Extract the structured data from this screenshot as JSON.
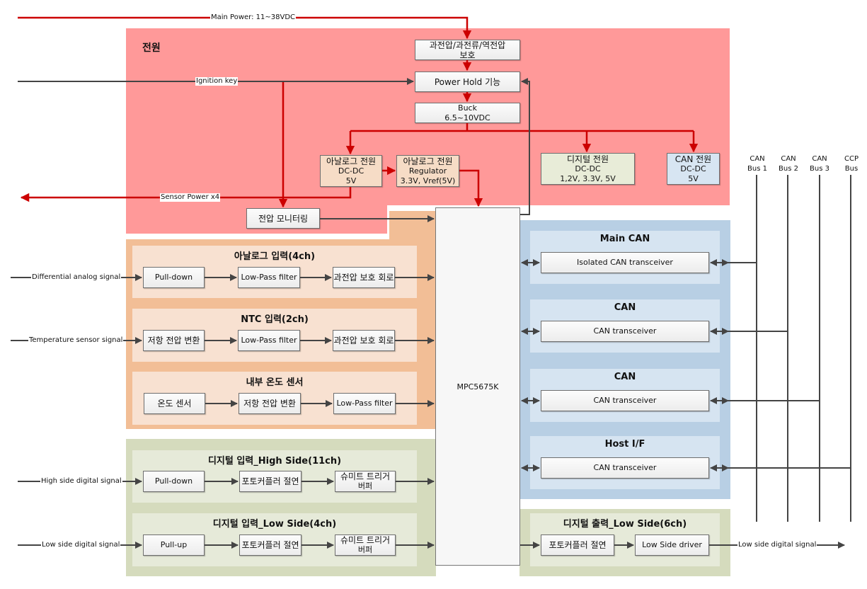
{
  "external_signals": {
    "main_power": "Main Power: 11~38VDC",
    "ignition_key": "Ignition key",
    "sensor_power": "Sensor Power x4",
    "differential_analog": "Differential analog signal",
    "temperature_sensor": "Temperature sensor signal",
    "high_side_digital": "High side digital signal",
    "low_side_digital_in": "Low side digital signal",
    "low_side_digital_out": "Low side digital signal"
  },
  "power_section": {
    "title": "전원",
    "protection": {
      "line1": "과전압/과전류/역전압",
      "line2": "보호"
    },
    "power_hold": "Power Hold 기능",
    "buck": {
      "line1": "Buck",
      "line2": "6.5~10VDC"
    },
    "analog_dcdc": {
      "line1": "아날로그 전원",
      "line2": "DC-DC",
      "line3": "5V"
    },
    "analog_regulator": {
      "line1": "아날로그 전원",
      "line2": "Regulator",
      "line3": "3.3V, Vref(5V)"
    },
    "digital_dcdc": {
      "line1": "디지털 전원",
      "line2": "DC-DC",
      "line3": "1,2V, 3.3V, 5V"
    },
    "can_dcdc": {
      "line1": "CAN 전원",
      "line2": "DC-DC",
      "line3": "5V"
    },
    "voltage_monitor": "전압 모니터링"
  },
  "analog_input": {
    "title": "아날로그 입력(4ch)",
    "blocks": [
      "Pull-down",
      "Low-Pass filter",
      "과전압 보호 회로"
    ]
  },
  "ntc_input": {
    "title": "NTC 입력(2ch)",
    "blocks": [
      "저항 전압 변환",
      "Low-Pass filter",
      "과전압 보호 회로"
    ]
  },
  "internal_temp": {
    "title": "내부 온도 센서",
    "blocks": [
      "온도 센서",
      "저항 전압 변환",
      "Low-Pass filter"
    ]
  },
  "digital_input_high": {
    "title": "디지털 입력_High Side(11ch)",
    "blocks": [
      "Pull-down",
      "포토커플러 절연",
      "슈미트 트리거",
      "버퍼"
    ]
  },
  "digital_input_low": {
    "title": "디지털 입력_Low Side(4ch)",
    "blocks": [
      "Pull-up",
      "포토커플러 절연",
      "슈미트 트리거",
      "버퍼"
    ]
  },
  "mcu": {
    "label": "MPC5675K"
  },
  "can_section": {
    "groups": [
      {
        "title": "Main CAN",
        "transceiver": "Isolated CAN transceiver"
      },
      {
        "title": "CAN",
        "transceiver": "CAN transceiver"
      },
      {
        "title": "CAN",
        "transceiver": "CAN transceiver"
      },
      {
        "title": "Host I/F",
        "transceiver": "CAN transceiver"
      }
    ]
  },
  "digital_output": {
    "title": "디지털 출력_Low Side(6ch)",
    "blocks": [
      "포토커플러 절연",
      "Low Side driver"
    ]
  },
  "buses": [
    {
      "line1": "CAN",
      "line2": "Bus 1"
    },
    {
      "line1": "CAN",
      "line2": "Bus 2"
    },
    {
      "line1": "CAN",
      "line2": "Bus 3"
    },
    {
      "line1": "CCP",
      "line2": "Bus"
    }
  ],
  "colors": {
    "power_wire": "#cc0000",
    "signal_wire": "#444444",
    "power_region": "#ff9999",
    "analog_region": "#f2be96",
    "digital_region": "#d5dbbd",
    "can_region": "#b8cfe4"
  }
}
